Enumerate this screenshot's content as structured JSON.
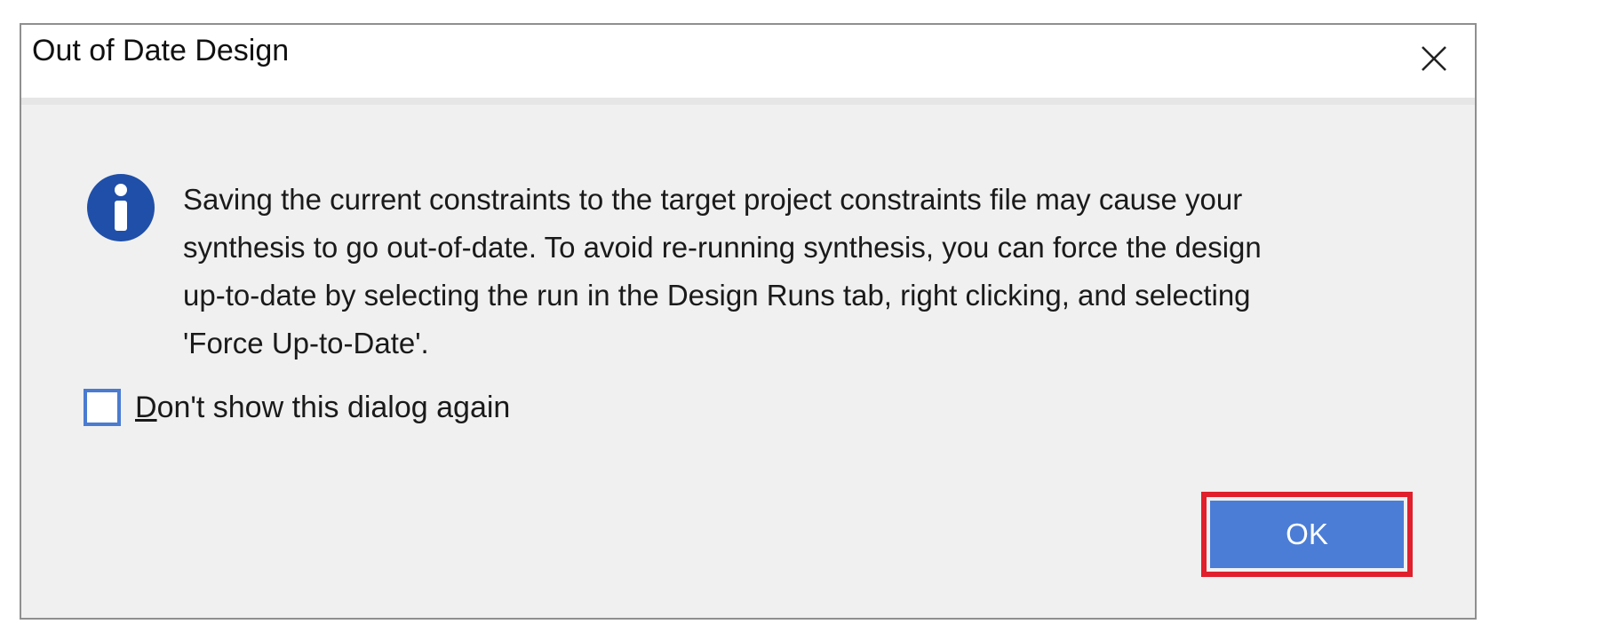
{
  "dialog": {
    "title": "Out of Date Design",
    "close_icon": "close-icon",
    "info_icon": "info-icon",
    "message_lines": [
      "Saving the current constraints to the target project constraints file may cause your",
      "synthesis to go out-of-date. To avoid re-running synthesis, you can force the design",
      "up-to-date by selecting the run in the Design Runs tab, right clicking, and selecting",
      "'Force Up-to-Date'."
    ],
    "checkbox": {
      "mnemonic": "D",
      "label_rest": "on't show this dialog again",
      "checked": false
    },
    "ok_label": "OK",
    "colors": {
      "accent": "#4b7dd6",
      "highlight_border": "#e0202c",
      "info_icon": "#1f4fa8"
    }
  }
}
